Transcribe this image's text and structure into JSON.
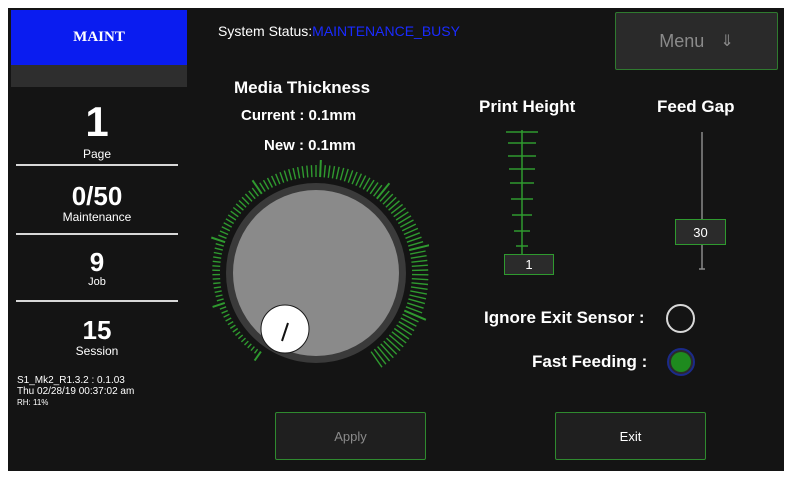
{
  "sidebar": {
    "mode": "MAINT",
    "stats": [
      {
        "value": "1",
        "label": "Page"
      },
      {
        "value": "0/50",
        "label": "Maintenance"
      },
      {
        "value": "9",
        "label": "Job"
      },
      {
        "value": "15",
        "label": "Session"
      }
    ],
    "firmware": "S1_Mk2_R1.3.2 : 0.1.03",
    "datetime": "Thu 02/28/19 00:37:02 am",
    "humidity": "RH: 11%"
  },
  "header": {
    "status_label": "System Status:",
    "status_value": "MAINTENANCE_BUSY",
    "menu_label": "Menu",
    "menu_icon": "⇓"
  },
  "media": {
    "title": "Media Thickness",
    "current": "Current : 0.1mm",
    "new": "New : 0.1mm",
    "knob_level": 0.0
  },
  "print_height": {
    "label": "Print Height",
    "value": "1"
  },
  "feed_gap": {
    "label": "Feed Gap",
    "value": "30"
  },
  "toggles": {
    "ignore_exit_label": "Ignore Exit Sensor :",
    "ignore_exit_on": false,
    "fast_feeding_label": "Fast Feeding :",
    "fast_feeding_on": true
  },
  "buttons": {
    "apply": "Apply",
    "exit": "Exit"
  },
  "colors": {
    "accent": "#2f9a2f",
    "mode_badge": "#0a1cf0",
    "status_value": "#1a2bff"
  }
}
